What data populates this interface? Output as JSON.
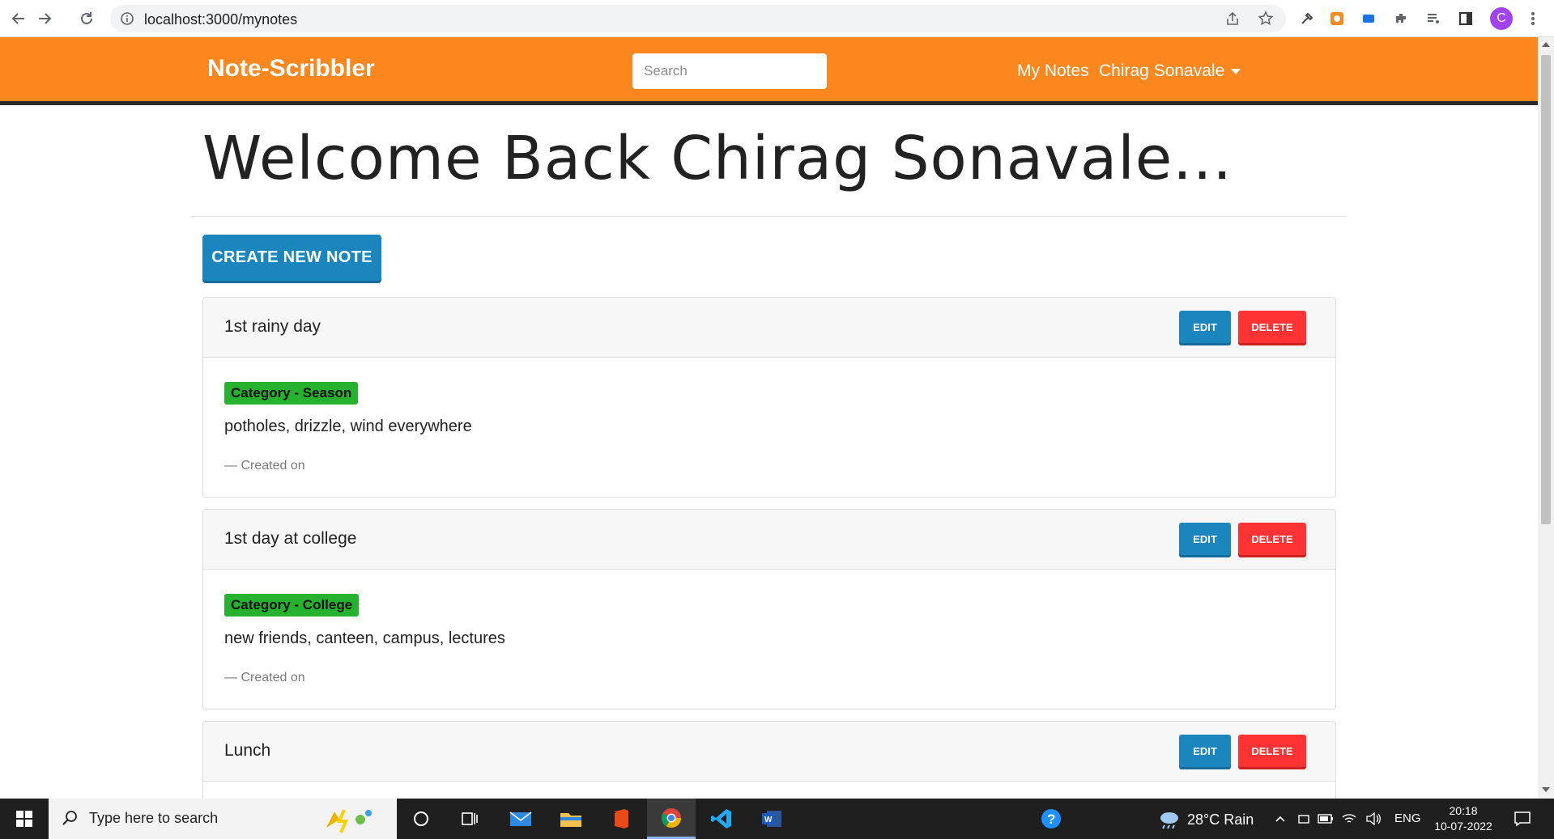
{
  "browser": {
    "url": "localhost:3000/mynotes",
    "profile_initial": "C"
  },
  "navbar": {
    "brand": "Note-Scribbler",
    "search_placeholder": "Search",
    "my_notes": "My Notes",
    "user": "Chirag Sonavale"
  },
  "main": {
    "welcome": "Welcome Back Chirag Sonavale...",
    "create_button": "CREATE NEW NOTE"
  },
  "notes": [
    {
      "title": "1st rainy day",
      "edit": "EDIT",
      "delete": "DELETE",
      "category": "Category - Season",
      "content": "potholes, drizzle, wind everywhere",
      "footer": "— Created on"
    },
    {
      "title": "1st day at college",
      "edit": "EDIT",
      "delete": "DELETE",
      "category": "Category - College",
      "content": "new friends, canteen, campus, lectures",
      "footer": "— Created on"
    },
    {
      "title": "Lunch",
      "edit": "EDIT",
      "delete": "DELETE"
    }
  ],
  "taskbar": {
    "search_text": "Type here to search",
    "weather": "28°C  Rain",
    "lang": "ENG",
    "time": "20:18",
    "date": "10-07-2022"
  },
  "colors": {
    "navbar": "#fd871f",
    "primary": "#1b86bd",
    "danger": "#ff3333",
    "badge": "#26b12f"
  }
}
